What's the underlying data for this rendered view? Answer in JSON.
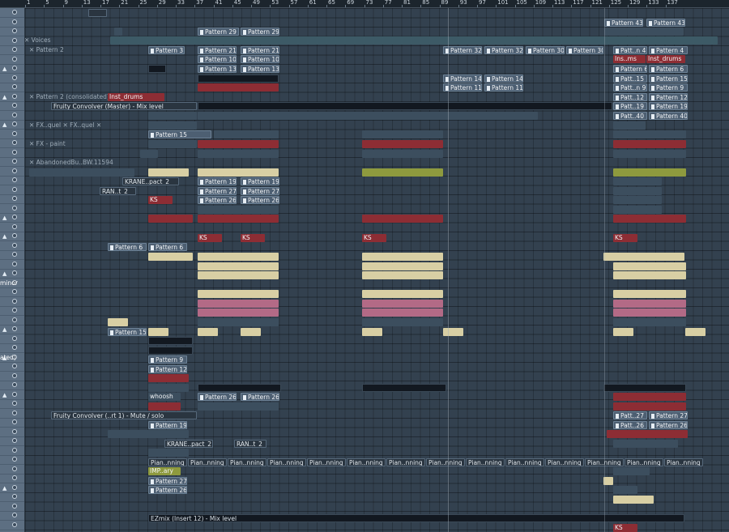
{
  "ruler": {
    "bars": [
      "1",
      "5",
      "9",
      "13",
      "17",
      "21",
      "25",
      "29",
      "33",
      "37",
      "41",
      "45",
      "49",
      "53",
      "57",
      "61",
      "65",
      "69",
      "73",
      "77",
      "81",
      "85",
      "89",
      "93",
      "97",
      "101",
      "105",
      "109",
      "113",
      "117",
      "121",
      "125",
      "129",
      "133",
      "137"
    ]
  },
  "colors": {
    "accent": "#4d5f72",
    "red_clip": "#8d2d34",
    "cream_clip": "#d8cfa4",
    "header_bg": "#5d6f82"
  },
  "track_labels": {
    "voices": "Voices",
    "pattern2": "Pattern 2",
    "pattern2_consolidated": "Pattern 2 (consolidated)",
    "inst_drums": "Inst_drums",
    "convolver_master": "Fruity Convolver (Master) - Mix level",
    "fx_quel_a": "FX..quel",
    "fx_quel_b": "FX..quel",
    "fx_paint": "FX - paint",
    "abandoned": "AbandonedBu..BW.11594",
    "krane_pact": "KRANE..pact_2",
    "ran_t2": "RAN..t_2",
    "ks": "KS",
    "convolver_mute": "Fruity Convolver (..rt 1) - Mute / solo",
    "whoosh": "whoosh",
    "imp_ary": "IMP..ary",
    "ezmix": "EZmix (Insert 12) - Mix level",
    "pian_nning": "Pian..nning",
    "minor_label": "minor",
    "ated_label": "ated)"
  },
  "patterns": {
    "p3": "Pattern 3",
    "p4": "Pattern 4",
    "p6": "Pattern 6",
    "p8": "Pattern 8",
    "p9": "Pattern 9",
    "p10": "Pattern 10",
    "p11": "Pattern 11",
    "p12": "Pattern 12",
    "p13": "Pattern 13",
    "p14": "Pattern 14",
    "p15": "Pattern 15",
    "p19": "Pattern 19",
    "p21": "Pattern 21",
    "p26": "Pattern 26",
    "p27": "Pattern 27",
    "p29": "Pattern 29",
    "p30": "Pattern 30",
    "p32": "Pattern 32",
    "p40": "Pattern 40",
    "p43": "Pattern 43",
    "patt_4": "Patt..n 4",
    "patt_8": "Patt..n 8",
    "patt_9": "Patt..n 9",
    "patt_12": "Patt..12",
    "patt_15": "Patt..15",
    "patt_19": "Patt..19",
    "patt_40": "Patt..40",
    "patt_26": "Patt..26",
    "patt_27": "Patt..27",
    "ins_ms": "Ins..ms",
    "inst_drums_short": "Inst_drums"
  }
}
